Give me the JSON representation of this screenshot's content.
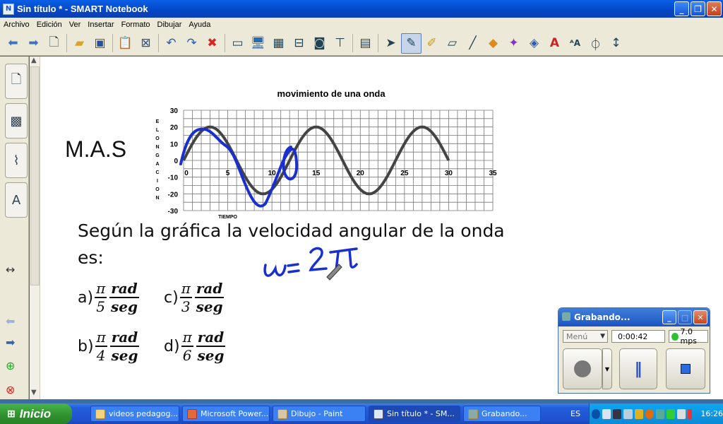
{
  "window": {
    "title": "Sin título * - SMART Notebook",
    "app_icon": "N"
  },
  "menu": [
    "Archivo",
    "Edición",
    "Ver",
    "Insertar",
    "Formato",
    "Dibujar",
    "Ayuda"
  ],
  "slide": {
    "label": "M.A.S",
    "question_line1": "Según la gráfica la velocidad angular de la onda",
    "question_line2": "es:",
    "options": [
      {
        "letter": "a)",
        "num": "π",
        "den": "5",
        "unit_num": "rad",
        "unit_den": "seg"
      },
      {
        "letter": "c)",
        "num": "π",
        "den": "3",
        "unit_num": "rad",
        "unit_den": "seg"
      },
      {
        "letter": "b)",
        "num": "π",
        "den": "4",
        "unit_num": "rad",
        "unit_den": "seg"
      },
      {
        "letter": "d)",
        "num": "π",
        "den": "6",
        "unit_num": "rad",
        "unit_den": "seg"
      }
    ],
    "handwriting": "ω= 2π"
  },
  "chart_data": {
    "type": "line",
    "title": "movimiento de una onda",
    "xlabel": "TIEMPO",
    "ylabel": "ELONGACION",
    "xlim": [
      0,
      35
    ],
    "ylim": [
      -30,
      30
    ],
    "x_ticks": [
      "0",
      "5",
      "10",
      "15",
      "20",
      "25",
      "30",
      "35"
    ],
    "y_ticks": [
      "30",
      "20",
      "10",
      "0",
      "-10",
      "-20",
      "-30"
    ],
    "grid": true,
    "series": [
      {
        "x": [
          0,
          3,
          6,
          9,
          12,
          15,
          18,
          21,
          24,
          27,
          30
        ],
        "y": [
          0,
          20,
          0,
          -20,
          0,
          20,
          0,
          -20,
          0,
          20,
          0
        ]
      }
    ]
  },
  "recorder": {
    "title": "Grabando...",
    "menu_label": "Menú",
    "time": "0:00:42",
    "rate": "7.0 mps"
  },
  "taskbar": {
    "start_label": "Inicio",
    "tasks": [
      {
        "label": "videos pedagog..."
      },
      {
        "label": "Microsoft Power..."
      },
      {
        "label": "Dibujo - Paint"
      },
      {
        "label": "Sin título * - SM..."
      },
      {
        "label": "Grabando..."
      }
    ],
    "lang": "ES",
    "clock": "16:26"
  },
  "colors": {
    "ink_blue": "#1a2fd0",
    "curve": "#444444",
    "titlebar": "#0a4fd6"
  }
}
